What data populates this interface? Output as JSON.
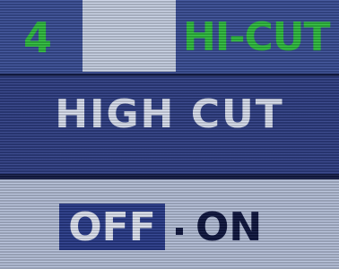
{
  "header": {
    "page_number": "4",
    "menu_name": "HI-CUT"
  },
  "item": {
    "title": "HIGH CUT"
  },
  "options": {
    "off_label": "OFF",
    "on_label": "ON",
    "selected": "OFF"
  },
  "colors": {
    "menu_green": "#2fbf3f",
    "panel_blue": "#2f3f86",
    "selection_blue": "#2a3c8c",
    "bottom_panel": "#b7c2dc",
    "text_light": "#dde3f3",
    "text_dark": "#0e1640"
  }
}
